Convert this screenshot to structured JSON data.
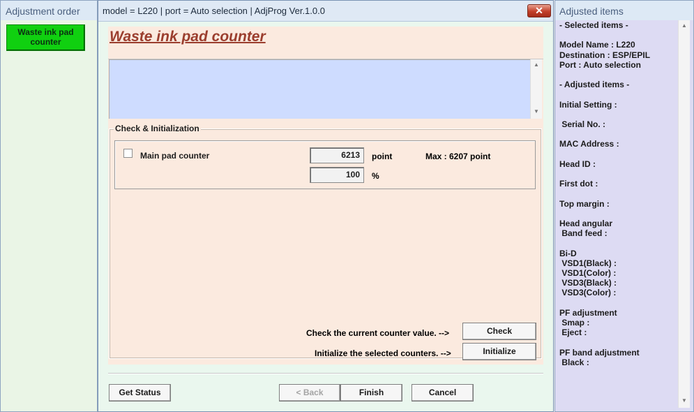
{
  "left_panel": {
    "title": "Adjustment order",
    "items": [
      {
        "label": "Waste ink pad counter"
      }
    ]
  },
  "window": {
    "title": "model = L220 | port = Auto selection | AdjProg Ver.1.0.0",
    "close_label": "✕"
  },
  "page": {
    "heading": "Waste ink pad counter",
    "group_title": "Check & Initialization",
    "checkbox_label": "Main pad counter",
    "counter_value": "6213",
    "counter_unit": "point",
    "percent_value": "100",
    "percent_unit": "%",
    "max_text": "Max : 6207 point",
    "check_desc": "Check the current counter value. -->",
    "check_button": "Check",
    "init_desc": "Initialize the selected counters. -->",
    "init_button": "Initialize"
  },
  "nav": {
    "get_status": "Get Status",
    "back": "< Back",
    "finish": "Finish",
    "cancel": "Cancel"
  },
  "right_panel": {
    "title": "Adjusted items",
    "text": "- Selected items -\n\nModel Name : L220\nDestination : ESP/EPIL\nPort : Auto selection\n\n- Adjusted items -\n\nInitial Setting :\n\n Serial No. :\n\nMAC Address :\n\nHead ID :\n\nFirst dot :\n\nTop margin :\n\nHead angular\n Band feed :\n\nBi-D\n VSD1(Black) :\n VSD1(Color) :\n VSD3(Black) :\n VSD3(Color) :\n\nPF adjustment\n Smap :\n Eject :\n\nPF band adjustment\n Black :"
  },
  "colors": {
    "heading": "#9b3e2e",
    "left_item": "#10d010",
    "blue_area": "#cedcff",
    "right_panel": "#dddbf3"
  }
}
